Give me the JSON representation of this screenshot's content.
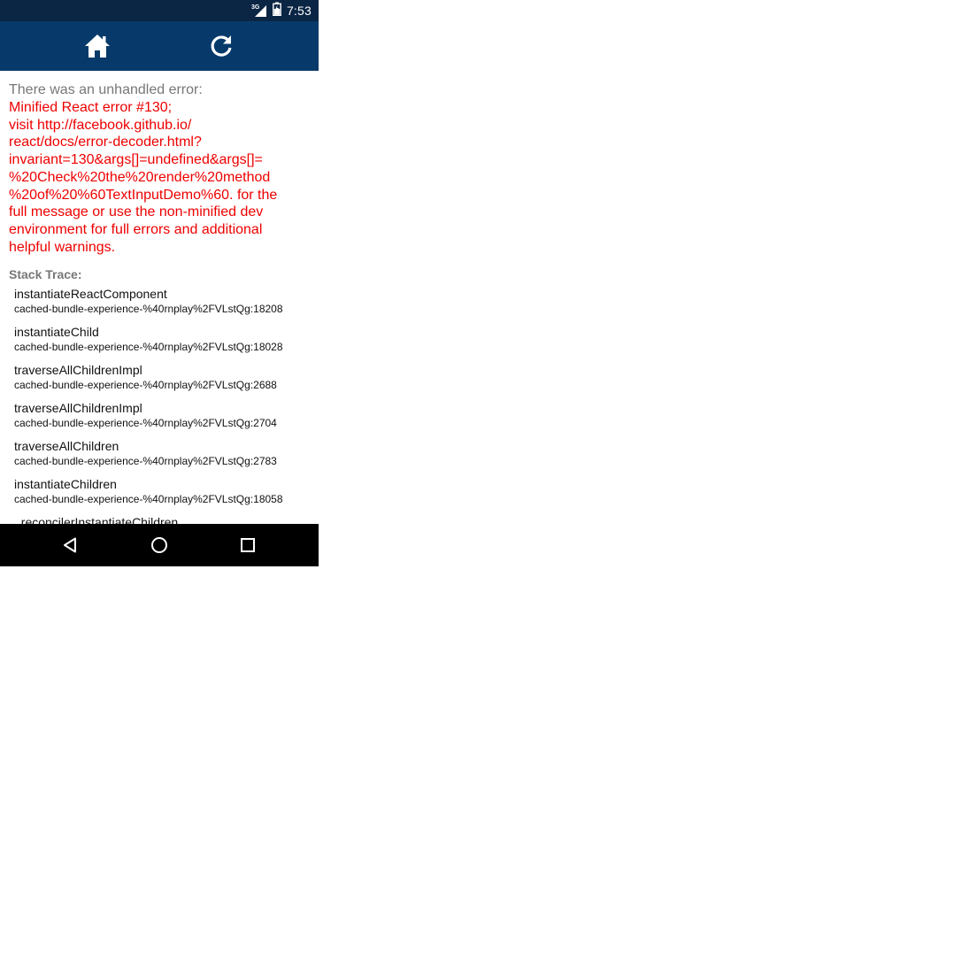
{
  "status_bar": {
    "network": "3G",
    "time": "7:53"
  },
  "toolbar": {
    "home_icon": "home-icon",
    "reload_icon": "reload-icon"
  },
  "error": {
    "heading": "There was an unhandled error:",
    "message": "Minified React error #130;\nvisit http://facebook.github.io/\nreact/docs/error-decoder.html?\ninvariant=130&args[]=undefined&args[]=\n%20Check%20the%20render%20method\n%20of%20%60TextInputDemo%60. for the\nfull message or use the non-minified dev\nenvironment for full errors and additional\nhelpful warnings."
  },
  "stack": {
    "title": "Stack Trace:",
    "frames": [
      {
        "fn": "instantiateReactComponent",
        "loc": "cached-bundle-experience-%40rnplay%2FVLstQg:18208"
      },
      {
        "fn": "instantiateChild",
        "loc": "cached-bundle-experience-%40rnplay%2FVLstQg:18028"
      },
      {
        "fn": "traverseAllChildrenImpl",
        "loc": "cached-bundle-experience-%40rnplay%2FVLstQg:2688"
      },
      {
        "fn": "traverseAllChildrenImpl",
        "loc": "cached-bundle-experience-%40rnplay%2FVLstQg:2704"
      },
      {
        "fn": "traverseAllChildren",
        "loc": "cached-bundle-experience-%40rnplay%2FVLstQg:2783"
      },
      {
        "fn": "instantiateChildren",
        "loc": "cached-bundle-experience-%40rnplay%2FVLstQg:18058"
      },
      {
        "fn": "_reconcilerInstantiateChildren",
        "loc": ""
      }
    ]
  },
  "nav_bar": {
    "back_icon": "back-triangle-icon",
    "home_icon": "home-circle-icon",
    "recents_icon": "recents-square-icon"
  },
  "colors": {
    "status_bar": "#0b2544",
    "toolbar": "#073a6a",
    "error_text": "#ee0000",
    "heading_text": "#777777",
    "nav_bar": "#000000"
  }
}
